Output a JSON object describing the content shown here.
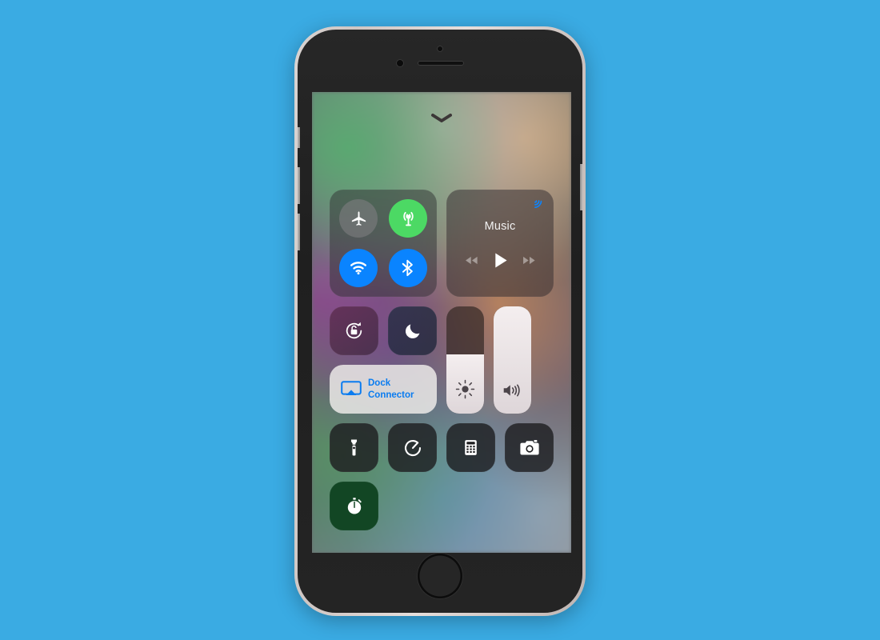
{
  "page": {
    "background_color": "#3aabe3",
    "device": "iPhone",
    "screen": "iOS Control Center"
  },
  "device_hardware": {
    "frame_color": "#d9d4d2",
    "body_color": "#232323",
    "buttons": [
      {
        "name": "silent-switch",
        "label": "Ring/Silent switch"
      },
      {
        "name": "volume-up-button",
        "label": "Volume Up"
      },
      {
        "name": "volume-down-button",
        "label": "Volume Down"
      },
      {
        "name": "power-button",
        "label": "Side / Power button"
      }
    ],
    "front_camera": "front-camera-icon",
    "earpiece": "earpiece-speaker",
    "proximity_sensor": "proximity-sensor",
    "home_button": "home-button"
  },
  "control_center": {
    "handle_icon": "chevron-down-icon",
    "connectivity": {
      "panel_name": "connectivity-panel",
      "toggles": [
        {
          "name": "airplane-mode-toggle",
          "icon": "airplane-icon",
          "state": "off",
          "color": "#7c7c80"
        },
        {
          "name": "cellular-data-toggle",
          "icon": "cellular-antenna-icon",
          "state": "on",
          "color": "#4cd964"
        },
        {
          "name": "wifi-toggle",
          "icon": "wifi-icon",
          "state": "on",
          "color": "#0a84ff"
        },
        {
          "name": "bluetooth-toggle",
          "icon": "bluetooth-icon",
          "state": "on",
          "color": "#0a84ff"
        }
      ]
    },
    "music": {
      "panel_name": "music-panel",
      "title": "Music",
      "airplay_route_icon": "airplay-audio-icon",
      "airplay_route_color": "#0a84ff",
      "transport": [
        {
          "name": "previous-track-button",
          "icon": "rewind-icon",
          "state": "dim"
        },
        {
          "name": "play-button",
          "icon": "play-icon",
          "state": "active"
        },
        {
          "name": "next-track-button",
          "icon": "fast-forward-icon",
          "state": "dim"
        }
      ]
    },
    "toggles_mid": [
      {
        "name": "rotation-lock-toggle",
        "icon": "rotation-lock-icon",
        "state": "off"
      },
      {
        "name": "do-not-disturb-toggle",
        "icon": "moon-icon",
        "state": "off"
      }
    ],
    "airplay_mirroring": {
      "name": "screen-mirroring-button",
      "icon": "screen-mirroring-icon",
      "label": "Dock Connector",
      "text_color": "#0a7cf0",
      "background_color": "#f0eeec"
    },
    "sliders": [
      {
        "name": "brightness-slider",
        "icon": "brightness-sun-icon",
        "value_percent": 55
      },
      {
        "name": "volume-slider",
        "icon": "speaker-waves-icon",
        "value_percent": 100
      }
    ],
    "shortcuts_row_1": [
      {
        "name": "flashlight-button",
        "icon": "flashlight-icon"
      },
      {
        "name": "timer-button",
        "icon": "timer-icon"
      },
      {
        "name": "calculator-button",
        "icon": "calculator-icon"
      },
      {
        "name": "camera-button",
        "icon": "camera-icon"
      }
    ],
    "shortcuts_row_2": [
      {
        "name": "stopwatch-button",
        "icon": "stopwatch-icon",
        "background_color": "#124624"
      }
    ]
  }
}
